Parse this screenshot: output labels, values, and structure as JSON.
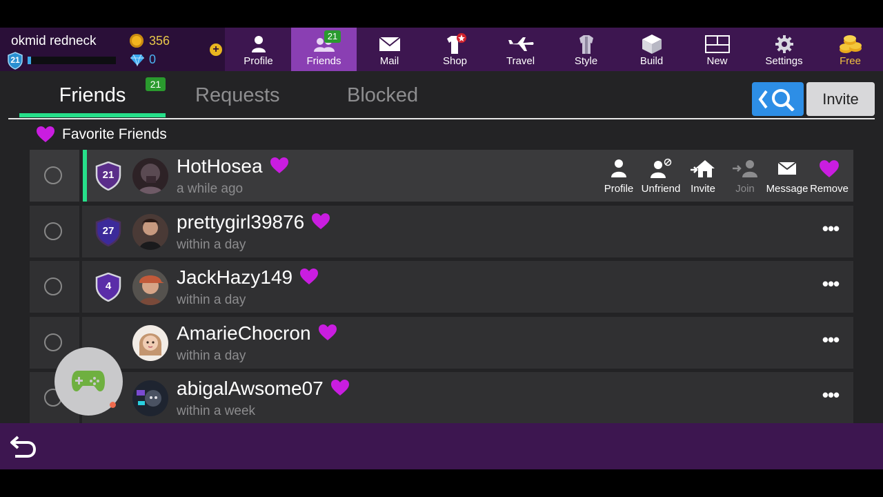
{
  "topbar": {
    "username": "okmid redneck",
    "level": "21",
    "xp_fraction": 0.04,
    "coins": "356",
    "gems": "0",
    "add_currency_symbol": "+",
    "tabs": [
      {
        "label": "Profile",
        "icon": "person-icon"
      },
      {
        "label": "Friends",
        "icon": "friends-icon",
        "badge": "21",
        "active": true
      },
      {
        "label": "Mail",
        "icon": "envelope-icon"
      },
      {
        "label": "Shop",
        "icon": "shop-icon"
      },
      {
        "label": "Travel",
        "icon": "airplane-icon"
      },
      {
        "label": "Style",
        "icon": "clothes-icon"
      },
      {
        "label": "Build",
        "icon": "cube-icon"
      },
      {
        "label": "New",
        "icon": "new-layout-icon"
      },
      {
        "label": "Settings",
        "icon": "gear-icon"
      },
      {
        "label": "Free",
        "icon": "coin-stack-icon"
      }
    ]
  },
  "subtabs": {
    "friends": "Friends",
    "friends_badge": "21",
    "requests": "Requests",
    "blocked": "Blocked"
  },
  "invite_label": "Invite",
  "favorites_label": "Favorite Friends",
  "friends": [
    {
      "name": "HotHosea",
      "status": "a while ago",
      "level": "21",
      "selected": true
    },
    {
      "name": "prettygirl39876",
      "status": "within a day",
      "level": "27"
    },
    {
      "name": "JackHazy149",
      "status": "within a day",
      "level": "4"
    },
    {
      "name": "AmarieChocron",
      "status": "within a day",
      "level": ""
    },
    {
      "name": "abigalAwsome07",
      "status": "within a week",
      "level": ""
    }
  ],
  "row_actions": {
    "profile": "Profile",
    "unfriend": "Unfriend",
    "invite": "Invite",
    "join": "Join",
    "message": "Message",
    "remove": "Remove"
  },
  "more_symbol": "•••",
  "colors": {
    "purple_bar": "#3d1650",
    "active_tab": "#8a3fb3",
    "accent_green": "#27e08a",
    "heart": "#c91de0",
    "search_blue": "#2d8ee6"
  }
}
